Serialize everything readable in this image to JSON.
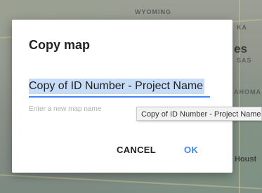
{
  "map": {
    "labels": [
      "WYOMING",
      "KA",
      "es",
      "SAS",
      "AHOMA",
      "Houst"
    ]
  },
  "dialog": {
    "title": "Copy map",
    "name_value": "Copy of ID Number - Project Name",
    "hint": "Enter a new map name",
    "tooltip": "Copy of ID Number - Project Name",
    "cancel_label": "CANCEL",
    "ok_label": "OK"
  },
  "colors": {
    "accent": "#4285f4",
    "selection": "#c6dcf7",
    "title_text": "#202124",
    "hint_text": "#b0b0b0"
  }
}
